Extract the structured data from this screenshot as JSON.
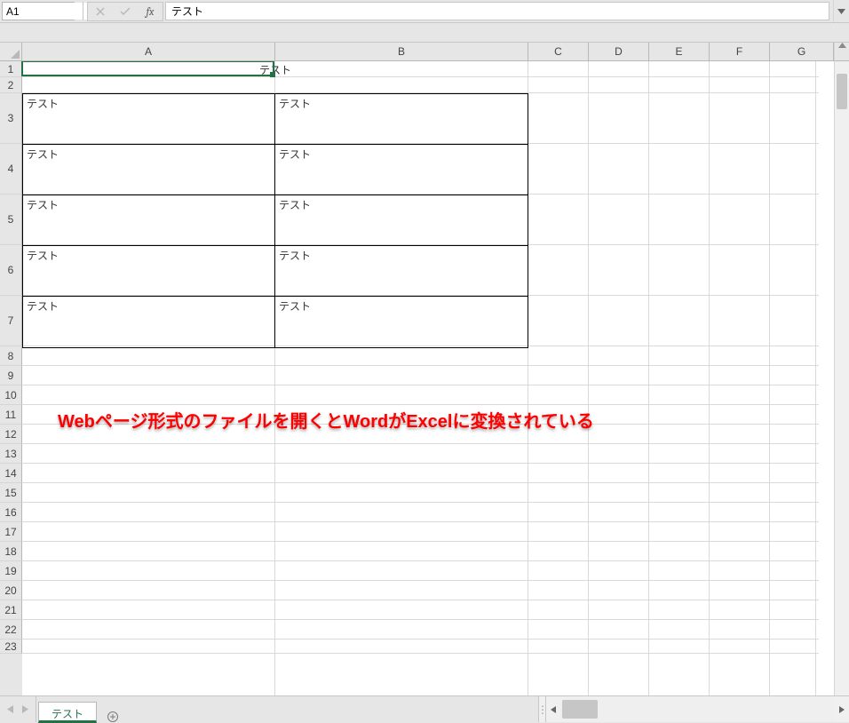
{
  "name_box": {
    "value": "A1"
  },
  "formula_bar": {
    "value": "テスト",
    "fx_label": "fx"
  },
  "columns": {
    "labels": [
      "A",
      "B",
      "C",
      "D",
      "E",
      "F",
      "G"
    ],
    "widths": [
      285,
      285,
      68,
      68,
      68,
      68,
      52
    ]
  },
  "rows": {
    "labels": [
      "1",
      "2",
      "3",
      "4",
      "5",
      "6",
      "7",
      "8",
      "9",
      "10",
      "11",
      "12",
      "13",
      "14",
      "15",
      "16",
      "17",
      "18",
      "19",
      "20",
      "21",
      "22",
      "23"
    ],
    "heights": [
      18,
      18,
      57,
      57,
      57,
      57,
      57,
      22,
      22,
      22,
      22,
      22,
      22,
      22,
      22,
      22,
      22,
      22,
      22,
      22,
      22,
      22,
      16
    ]
  },
  "title_cell": {
    "text": "テスト"
  },
  "table": {
    "rows": [
      {
        "a": "テスト",
        "b": "テスト"
      },
      {
        "a": "テスト",
        "b": "テスト"
      },
      {
        "a": "テスト",
        "b": "テスト"
      },
      {
        "a": "テスト",
        "b": "テスト"
      },
      {
        "a": "テスト",
        "b": "テスト"
      }
    ]
  },
  "annotation": {
    "text": "Webページ形式のファイルを開くとWordがExcelに変換されている"
  },
  "sheet_tab": {
    "name": "テスト"
  }
}
